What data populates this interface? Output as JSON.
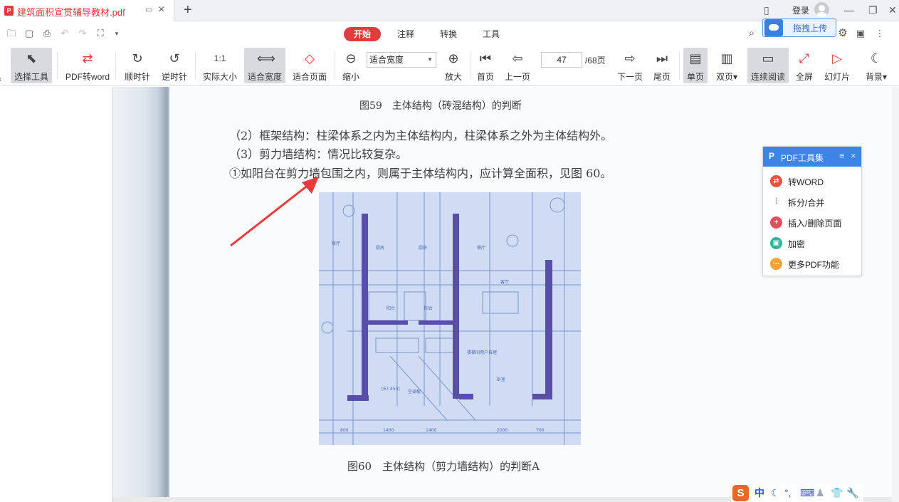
{
  "tab": {
    "title": "建筑面积宣贯辅导教材.pdf"
  },
  "account": {
    "login_label": "登录"
  },
  "menu": {
    "items": [
      "开始",
      "注释",
      "转换",
      "工具"
    ],
    "active": "开始"
  },
  "upload": {
    "label": "拖拽上传"
  },
  "toolbar": {
    "select_tool": "选择工具",
    "pdf_to_word": "PDF转word",
    "rotate_cw": "顺时针",
    "rotate_ccw": "逆时针",
    "actual_size": "实际大小",
    "fit_width": "适合宽度",
    "fit_page": "适合页面",
    "zoom_out": "缩小",
    "zoom_in": "放大",
    "zoom_value": "适合宽度",
    "first_page": "首页",
    "prev_page": "上一页",
    "current_page": "47",
    "total_pages": "/68页",
    "next_page": "下一页",
    "last_page": "尾页",
    "single_page": "单页",
    "double_page": "双页",
    "continuous": "连续阅读",
    "fullscreen": "全屏",
    "slideshow": "幻灯片",
    "background": "背景"
  },
  "document": {
    "fig59_caption": "图59　主体结构（砖混结构）的判断",
    "line1": "（2）框架结构：柱梁体系之内为主体结构内，柱梁体系之外为主体结构外。",
    "line2": "（3）剪力墙结构：情况比较复杂。",
    "line3": "①如阳台在剪力墙包围之内，则属于主体结构内，应计算全面积，见图 60。",
    "fig60_caption": "图60　主体结构（剪力墙结构）的判断A"
  },
  "pdf_panel": {
    "title": "PDF工具集",
    "items": [
      {
        "label": "转WORD",
        "color": "#e8553a"
      },
      {
        "label": "拆分/合并",
        "color": "#4a6fd6"
      },
      {
        "label": "插入/删除页面",
        "color": "#e0505a"
      },
      {
        "label": "加密",
        "color": "#2fb59a"
      },
      {
        "label": "更多PDF功能",
        "color": "#f3a33a"
      }
    ]
  },
  "ime": {
    "mode": "中"
  },
  "colors": {
    "accent": "#e23b3b",
    "panel_header": "#3b85e6",
    "annotation_arrow": "#e83a3a",
    "plan_background": "#cfdcf3"
  }
}
